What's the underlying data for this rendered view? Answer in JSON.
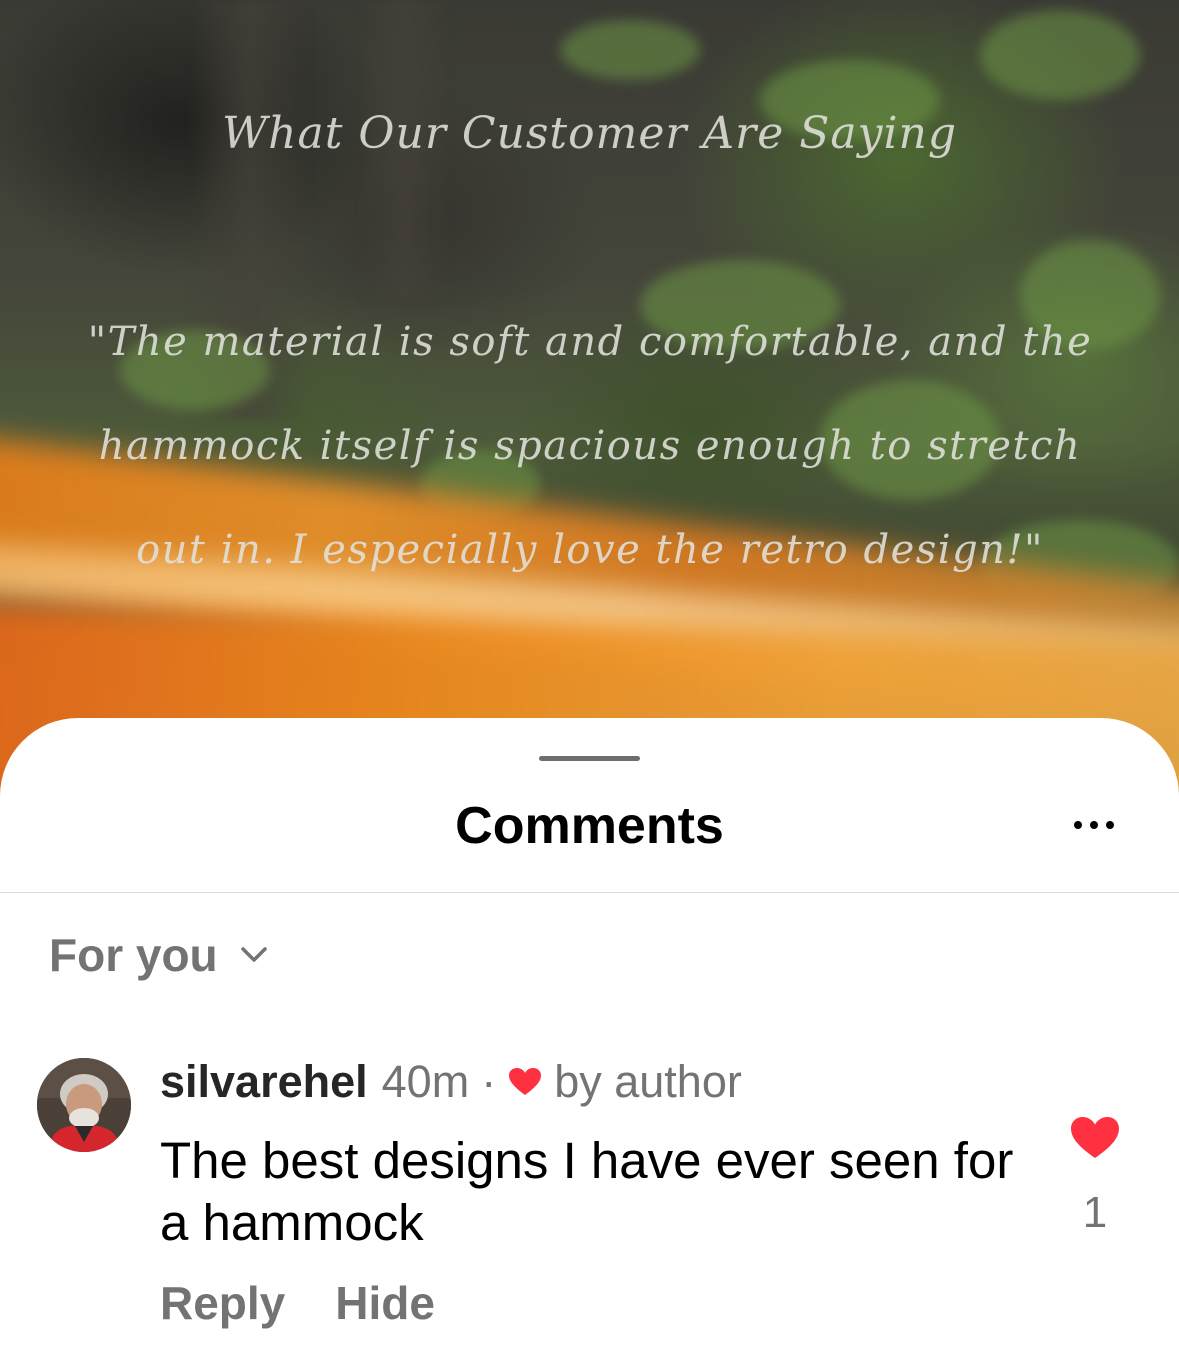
{
  "video": {
    "title": "What Our Customer Are Saying",
    "quote_lines": [
      "\"The material is soft and comfortable, and the",
      "hammock itself is spacious enough to stretch",
      "out in. I especially love the retro design!\""
    ]
  },
  "comments_sheet": {
    "title": "Comments",
    "more_icon": "more-horizontal-icon",
    "filter": {
      "label": "For you",
      "icon": "chevron-down-icon"
    },
    "comments": [
      {
        "username": "silvarehel",
        "time": "40m",
        "separator": "·",
        "author_badge": "by author",
        "badge_icon": "heart-icon",
        "badge_color": "#ff3040",
        "text": "The best designs I have ever seen for a hammock",
        "like_count": "1",
        "liked": true,
        "actions": {
          "reply": "Reply",
          "hide": "Hide"
        }
      }
    ]
  },
  "colors": {
    "like": "#ff3040",
    "secondary_text": "#737373",
    "primary_text": "#000000"
  }
}
